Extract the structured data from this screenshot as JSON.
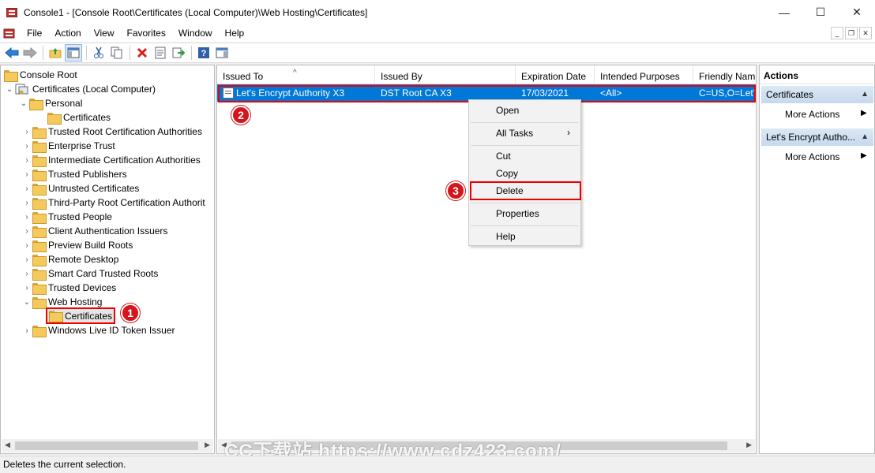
{
  "window": {
    "title": "Console1 - [Console Root\\Certificates (Local Computer)\\Web Hosting\\Certificates]",
    "minimize": "—",
    "maximize": "☐",
    "close": "✕"
  },
  "menubar": {
    "items": [
      "File",
      "Action",
      "View",
      "Favorites",
      "Window",
      "Help"
    ]
  },
  "toolbar": {
    "icons": [
      "back-arrow-icon",
      "forward-arrow-icon",
      "up-folder-icon",
      "show-hide-tree-icon",
      "cut-icon",
      "copy-icon",
      "delete-icon",
      "properties-icon",
      "export-icon",
      "help-icon",
      "show-hide-action-pane-icon"
    ]
  },
  "tree": {
    "root": "Console Root",
    "store": "Certificates (Local Computer)",
    "personal": "Personal",
    "personal_certs": "Certificates",
    "items": [
      "Trusted Root Certification Authorities",
      "Enterprise Trust",
      "Intermediate Certification Authorities",
      "Trusted Publishers",
      "Untrusted Certificates",
      "Third-Party Root Certification Authorit",
      "Trusted People",
      "Client Authentication Issuers",
      "Preview Build Roots",
      "Remote Desktop",
      "Smart Card Trusted Roots",
      "Trusted Devices"
    ],
    "web_hosting": "Web Hosting",
    "web_hosting_certs": "Certificates",
    "last": "Windows Live ID Token Issuer"
  },
  "list": {
    "columns": [
      "Issued To",
      "Issued By",
      "Expiration Date",
      "Intended Purposes",
      "Friendly Nam"
    ],
    "rows": [
      {
        "issued_to": "Let's Encrypt Authority X3",
        "issued_by": "DST Root CA X3",
        "expiration": "17/03/2021",
        "purposes": "<All>",
        "friendly": "C=US,O=Let'"
      }
    ]
  },
  "context_menu": {
    "open": "Open",
    "all_tasks": "All Tasks",
    "cut": "Cut",
    "copy": "Copy",
    "delete": "Delete",
    "properties": "Properties",
    "help": "Help"
  },
  "badges": [
    "1",
    "2",
    "3"
  ],
  "actions": {
    "title": "Actions",
    "section1": "Certificates",
    "more1": "More Actions",
    "section2": "Let's Encrypt Autho...",
    "more2": "More Actions"
  },
  "status": "Deletes the current selection.",
  "watermark": "CC下载站 https://www.cdz423.com/",
  "colors": {
    "selection": "#0078d7",
    "highlight_border": "#e00000",
    "badge": "#d4161c"
  }
}
